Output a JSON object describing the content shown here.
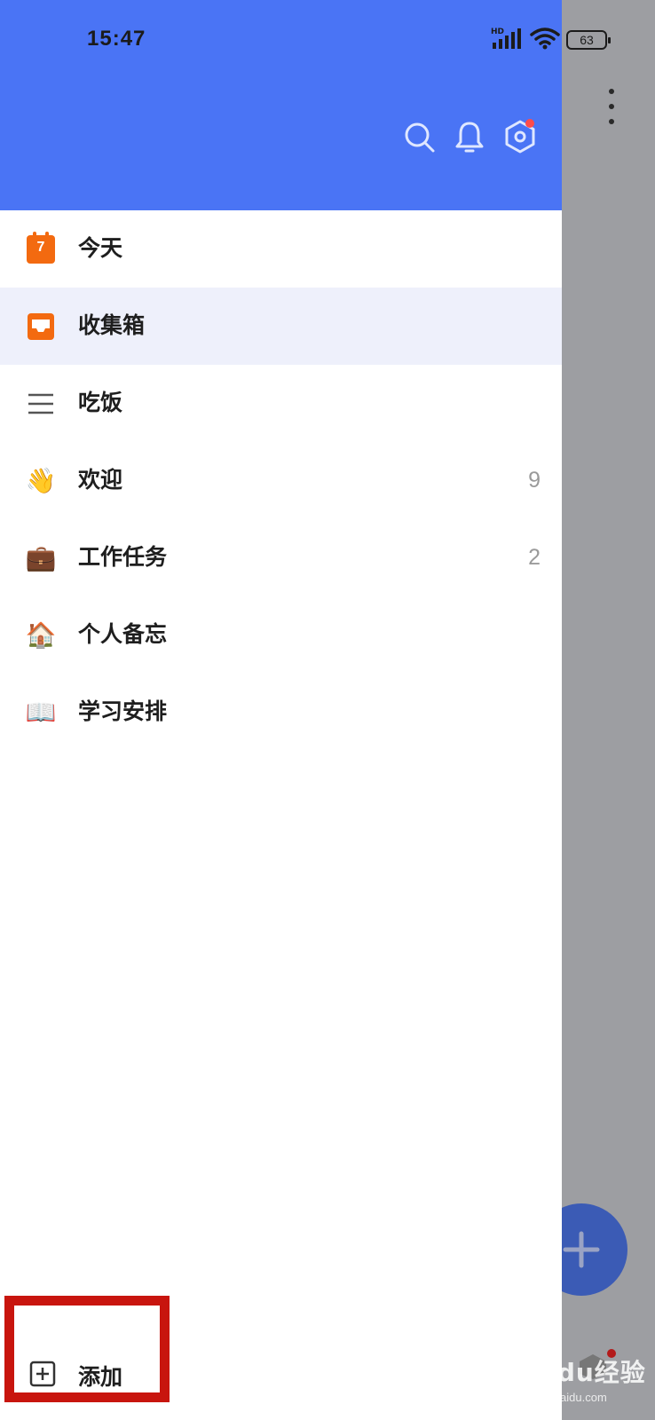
{
  "status_bar": {
    "time": "15:47",
    "network": "HD",
    "battery": "63"
  },
  "header": {
    "icons": [
      "search-icon",
      "bell-icon",
      "settings-icon"
    ],
    "accent": "#4a74f5"
  },
  "lists": [
    {
      "label": "今天",
      "icon": "calendar-icon",
      "calendar_day": "7",
      "count": ""
    },
    {
      "label": "收集箱",
      "icon": "inbox-icon",
      "count": "",
      "selected": true
    },
    {
      "label": "吃饭",
      "icon": "list-icon",
      "count": ""
    },
    {
      "label": "欢迎",
      "icon": "waving-hand-icon",
      "emoji": "👋",
      "count": "9"
    },
    {
      "label": "工作任务",
      "icon": "briefcase-icon",
      "emoji": "💼",
      "count": "2"
    },
    {
      "label": "个人备忘",
      "icon": "house-icon",
      "emoji": "🏠",
      "count": ""
    },
    {
      "label": "学习安排",
      "icon": "book-icon",
      "emoji": "📖",
      "count": ""
    }
  ],
  "footer": {
    "add_label": "添加"
  },
  "watermark": {
    "main": "Baidu经验",
    "sub": "jingyan.baidu.com"
  }
}
